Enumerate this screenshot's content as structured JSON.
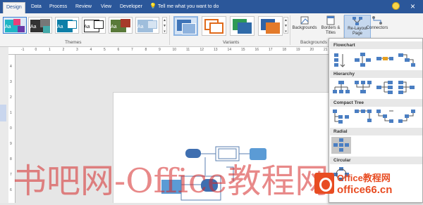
{
  "tabs": [
    {
      "label": "Design",
      "active": true
    },
    {
      "label": "Data"
    },
    {
      "label": "Process"
    },
    {
      "label": "Review"
    },
    {
      "label": "View"
    },
    {
      "label": "Developer"
    }
  ],
  "tell_me": "Tell me what you want to do",
  "ribbon": {
    "themes_label": "Themes",
    "variants_label": "Variants",
    "backgrounds_group_label": "Backgrounds",
    "backgrounds_btn": "Backgrounds",
    "borders_btn": "Borders & Titles",
    "relayout_btn": "Re-Layout Page",
    "connectors_btn": "Connectors",
    "theme_glyph": "Aa"
  },
  "ruler": {
    "top_ticks": [
      "-1",
      "0",
      "1",
      "2",
      "3",
      "4",
      "5",
      "6",
      "7",
      "8",
      "9",
      "10",
      "11",
      "12",
      "13",
      "14",
      "15",
      "16",
      "17",
      "18",
      "19",
      "20",
      "21"
    ],
    "left_ticks": [
      "4",
      "3",
      "2",
      "1",
      "0",
      "9",
      "8",
      "7",
      "6"
    ]
  },
  "panel": {
    "sections": [
      "Flowchart",
      "Hierarchy",
      "Compact Tree",
      "Radial",
      "Circular"
    ]
  },
  "watermark": {
    "cn_text": "书吧网-Office教程网",
    "logo_line1": "Office教程网",
    "logo_line2": "office66.cn"
  },
  "colors": {
    "tabbar": "#2b579a",
    "accent": "#4a7ec2",
    "watermark_red": "#d62828",
    "logo_orange": "#e84c22"
  }
}
